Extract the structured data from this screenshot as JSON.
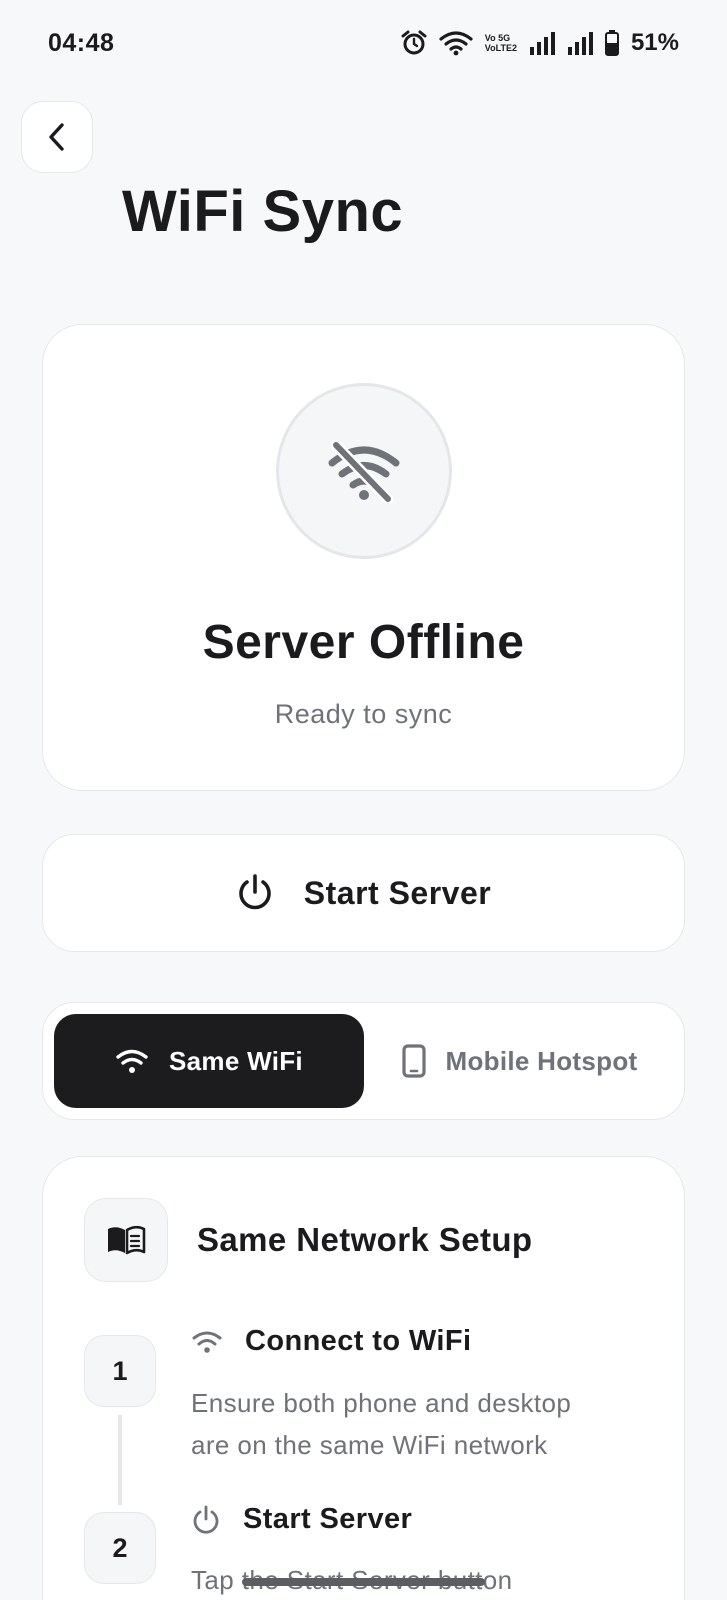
{
  "status_bar": {
    "time": "04:48",
    "volte_line1": "Vo 5G",
    "volte_line2": "VoLTE2",
    "battery": "51%"
  },
  "header": {
    "back_icon": "chevron-left-icon",
    "title": "WiFi Sync"
  },
  "server_status": {
    "icon": "wifi-off-icon",
    "title": "Server Offline",
    "subtitle": "Ready to sync"
  },
  "start_button": {
    "icon": "power-icon",
    "label": "Start Server"
  },
  "mode_toggle": {
    "options": [
      {
        "label": "Same WiFi",
        "icon": "wifi-icon",
        "active": true
      },
      {
        "label": "Mobile Hotspot",
        "icon": "phone-icon",
        "active": false
      }
    ]
  },
  "setup": {
    "icon": "book-icon",
    "title": "Same Network Setup",
    "steps": [
      {
        "number": "1",
        "icon": "wifi-icon",
        "title": "Connect to WiFi",
        "description_line1": "Ensure both phone and desktop",
        "description_line2": "are on the same WiFi network"
      },
      {
        "number": "2",
        "icon": "power-icon",
        "title": "Start Server",
        "description_line1": "Tap the Start Server button"
      }
    ]
  },
  "colors": {
    "background": "#f7f8fa",
    "card": "#ffffff",
    "border": "#e6e7ea",
    "text": "#1b1b1d",
    "muted_text": "#6f7279",
    "active_segment": "#1c1c1e"
  }
}
